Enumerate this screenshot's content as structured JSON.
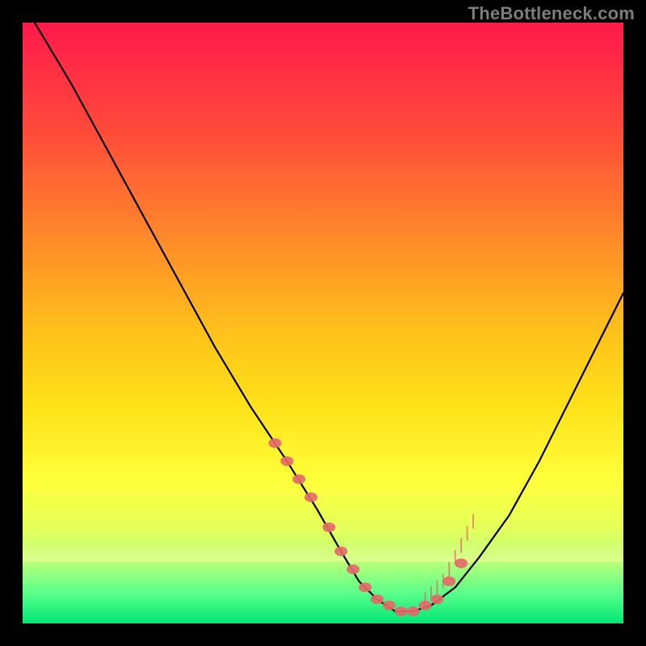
{
  "watermark": "TheBottleneck.com",
  "chart_data": {
    "type": "line",
    "title": "",
    "xlabel": "",
    "ylabel": "",
    "xlim": [
      0,
      100
    ],
    "ylim": [
      0,
      100
    ],
    "grid": false,
    "series": [
      {
        "name": "curve",
        "x": [
          2,
          8,
          14,
          20,
          26,
          32,
          38,
          44,
          49,
          53,
          56,
          59,
          62,
          65,
          68,
          72,
          76,
          81,
          86,
          91,
          96,
          100
        ],
        "y": [
          100,
          90,
          79,
          68,
          57,
          46,
          36,
          27,
          19,
          12,
          7,
          4,
          2,
          2,
          3,
          6,
          11,
          18,
          27,
          37,
          47,
          55
        ]
      }
    ],
    "markers": {
      "name": "highlight-points",
      "color": "#e46a6a",
      "x": [
        42,
        44,
        46,
        48,
        51,
        53,
        55,
        57,
        59,
        61,
        63,
        65,
        67,
        69,
        71,
        73
      ],
      "y": [
        30,
        27,
        24,
        21,
        16,
        12,
        9,
        6,
        4,
        3,
        2,
        2,
        3,
        4,
        7,
        10
      ]
    },
    "tick_marks": {
      "name": "inner-ticks",
      "color": "#e46a6a",
      "x": [
        67,
        68,
        69,
        70,
        71,
        72,
        73,
        74,
        75
      ],
      "y": [
        4,
        5,
        6,
        7,
        9,
        11,
        13,
        15,
        17
      ]
    }
  }
}
